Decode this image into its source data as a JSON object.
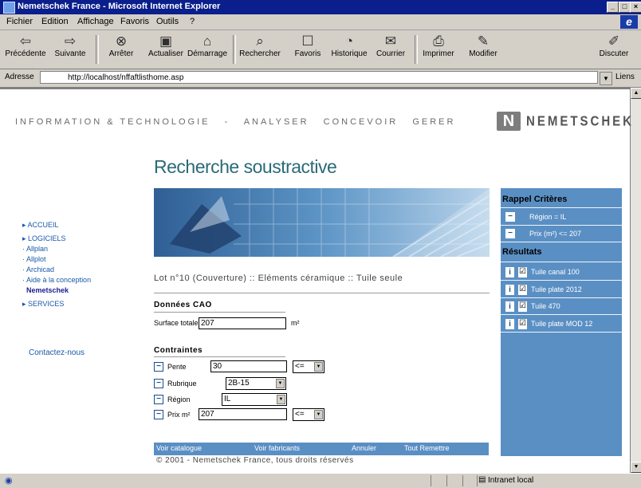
{
  "window": {
    "title": "Nemetschek France - Microsoft Internet Explorer"
  },
  "menu": [
    "Fichier",
    "Edition",
    "Affichage",
    "Favoris",
    "Outils",
    "?"
  ],
  "toolbar": [
    {
      "label": "Précédente",
      "icon": "back-arrow-icon"
    },
    {
      "label": "Suivante",
      "icon": "forward-arrow-icon"
    },
    {
      "label": "Arrêter",
      "icon": "stop-icon"
    },
    {
      "label": "Actualiser",
      "icon": "refresh-icon"
    },
    {
      "label": "Démarrage",
      "icon": "home-icon"
    },
    {
      "label": "Rechercher",
      "icon": "search-icon"
    },
    {
      "label": "Favoris",
      "icon": "favorites-icon"
    },
    {
      "label": "Historique",
      "icon": "history-icon"
    },
    {
      "label": "Courrier",
      "icon": "mail-icon"
    },
    {
      "label": "Imprimer",
      "icon": "print-icon"
    },
    {
      "label": "Modifier",
      "icon": "edit-icon"
    },
    {
      "label": "Discuter",
      "icon": "discuss-icon"
    }
  ],
  "address": {
    "label": "Adresse",
    "url": "http://localhost/nffaftlisthome.asp",
    "go": "Liens"
  },
  "status": {
    "zone": "Intranet local"
  },
  "page": {
    "nav": [
      "INFORMATION & TECHNOLOGIE",
      "-",
      "ANALYSER",
      "CONCEVOIR",
      "GERER"
    ],
    "logo_mark": "N",
    "logo_word": "NEMETSCHEK",
    "title": "Recherche soustractive",
    "left_nav": [
      {
        "label": "ACCUEIL",
        "arrow": true,
        "current": false
      },
      {
        "label": "LOGICIELS",
        "arrow": true,
        "current": false
      },
      {
        "label": "Allplan",
        "arrow": false,
        "current": false
      },
      {
        "label": "Allplot",
        "arrow": false,
        "current": false
      },
      {
        "label": "Archicad",
        "arrow": false,
        "current": false
      },
      {
        "label": "Aide à la conception",
        "arrow": false,
        "current": false
      },
      {
        "label": "Nemetschek",
        "arrow": false,
        "current": true
      },
      {
        "label": "SERVICES",
        "arrow": true,
        "current": false
      }
    ],
    "contact": "Contactez-nous",
    "breadcrumb": "Lot n°10 (Couverture) :: Eléments céramique :: Tuile seule",
    "cad_section": "Données CAO",
    "surface_label": "Surface totale",
    "surface_value": "207",
    "surface_unit": "m²",
    "constraints_section": "Contraintes",
    "constraints": [
      {
        "label": "Pente",
        "value": "30",
        "op": "<="
      },
      {
        "label": "Rubrique",
        "value": "2B-15",
        "op": ""
      },
      {
        "label": "Région",
        "value": "IL",
        "op": ""
      },
      {
        "label": "Prix m²",
        "value": "207",
        "op": "<="
      }
    ],
    "actions": [
      "Voir catalogue",
      "Voir fabricants",
      "Annuler",
      "Tout Remettre"
    ],
    "footer": "© 2001 - Nemetschek France, tous droits réservés",
    "reminder_title": "Rappel Critères",
    "reminders": [
      "Région = IL",
      "Prix (m²) <= 207"
    ],
    "results_title": "Résultats",
    "results": [
      "Tuile canal 100",
      "Tuile plate 2012",
      "Tuile 470",
      "Tuile plate MOD 12"
    ]
  }
}
